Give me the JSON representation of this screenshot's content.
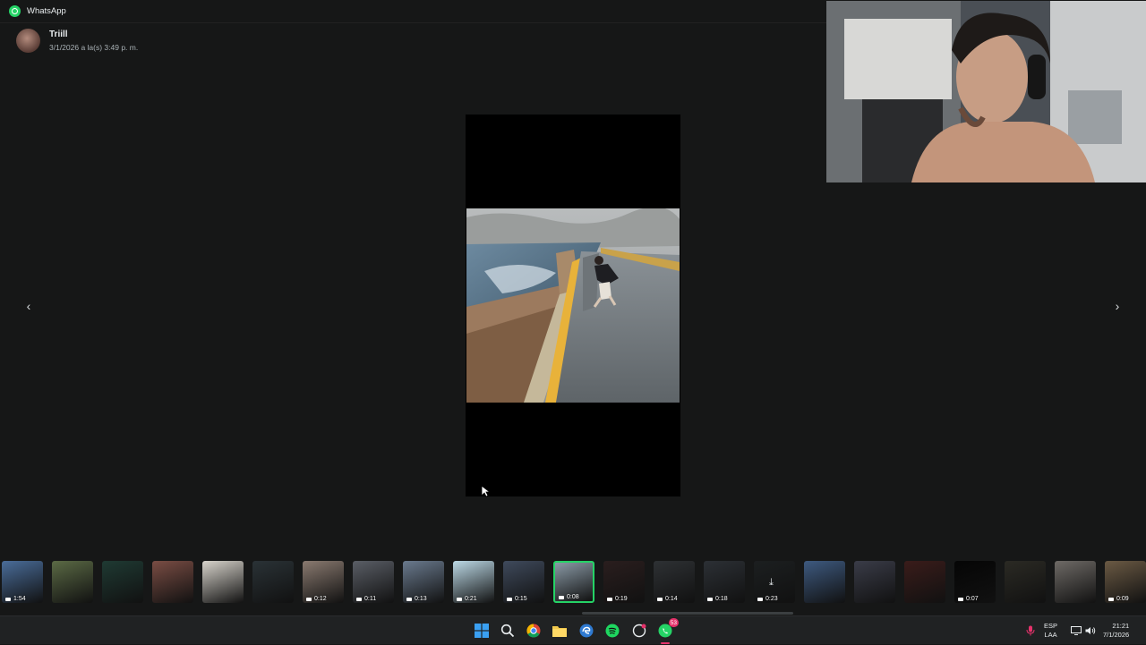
{
  "window": {
    "app_title": "WhatsApp"
  },
  "sender": {
    "name": "Triill",
    "timestamp": "3/1/2026 a la(s) 3:49 p. m."
  },
  "viewer": {
    "prev_icon": "chevron-left-icon",
    "next_icon": "chevron-right-icon"
  },
  "thumbnails": [
    {
      "duration": "1:54",
      "color": "#4a6d9a"
    },
    {
      "duration": "",
      "color": "#5b6a45"
    },
    {
      "duration": "",
      "color": "#1f3a33"
    },
    {
      "duration": "",
      "color": "#7a4d44"
    },
    {
      "duration": "",
      "color": "#d8d4cc"
    },
    {
      "duration": "",
      "color": "#2a3236"
    },
    {
      "duration": "0:12",
      "color": "#8a7a70"
    },
    {
      "duration": "0:11",
      "color": "#5a5e66"
    },
    {
      "duration": "0:13",
      "color": "#6a7a8e"
    },
    {
      "duration": "0:21",
      "color": "#bcd9e6"
    },
    {
      "duration": "0:15",
      "color": "#3f4a5c"
    },
    {
      "duration": "0:08",
      "color": "#8a9aa6",
      "selected": true
    },
    {
      "duration": "0:19",
      "color": "#2a1e1e"
    },
    {
      "duration": "0:14",
      "color": "#2e3134"
    },
    {
      "duration": "0:18",
      "color": "#2c3035"
    },
    {
      "duration": "0:23",
      "color": "#1c1f20",
      "download": true
    },
    {
      "duration": "",
      "color": "#3e5a80"
    },
    {
      "duration": "",
      "color": "#3a3c48"
    },
    {
      "duration": "",
      "color": "#3a1c1a"
    },
    {
      "duration": "0:07",
      "color": "#050505"
    },
    {
      "duration": "",
      "color": "#2b2a24"
    },
    {
      "duration": "",
      "color": "#6e6a66"
    },
    {
      "duration": "0:09",
      "color": "#6b5a44"
    }
  ],
  "taskbar": {
    "apps": [
      "windows-start-icon",
      "search-icon",
      "chrome-icon",
      "file-explorer-icon",
      "edge-icon",
      "spotify-icon",
      "app-icon",
      "whatsapp-icon"
    ],
    "whatsapp_badge": "53",
    "lang_line1": "ESP",
    "lang_line2": "LAA",
    "time": "21:21",
    "date": "7/1/2026"
  },
  "colors": {
    "accent": "#25d366",
    "background": "#161717",
    "badge": "#e5326b"
  }
}
